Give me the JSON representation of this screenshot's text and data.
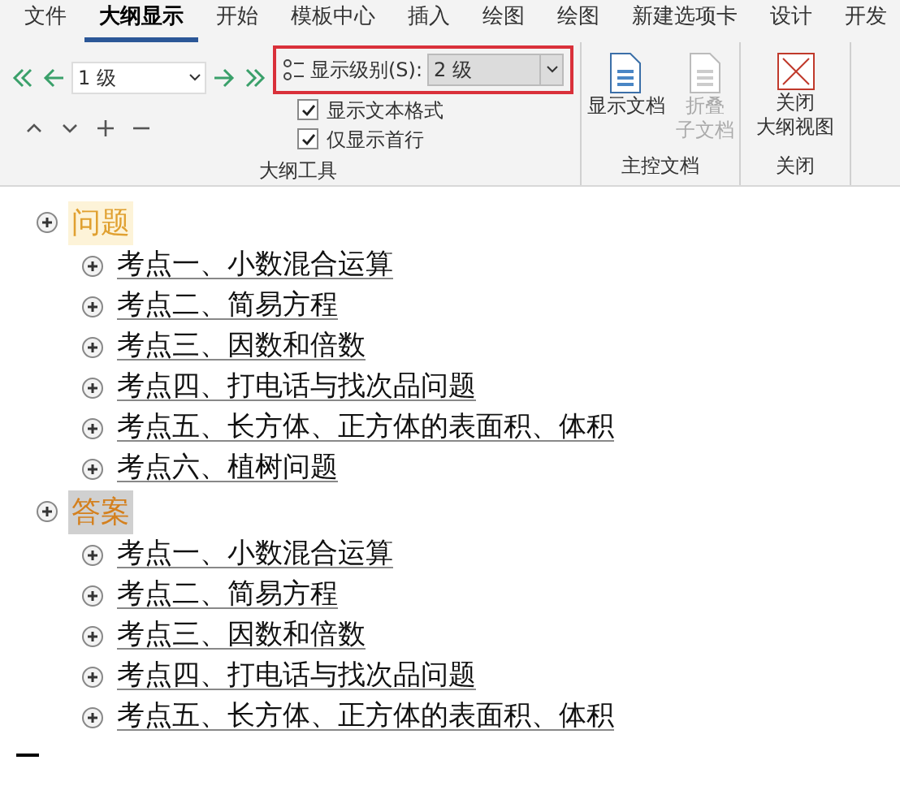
{
  "tabs": [
    {
      "label": "文件",
      "selected": false
    },
    {
      "label": "大纲显示",
      "selected": true
    },
    {
      "label": "开始",
      "selected": false
    },
    {
      "label": "模板中心",
      "selected": false
    },
    {
      "label": "插入",
      "selected": false
    },
    {
      "label": "绘图",
      "selected": false
    },
    {
      "label": "绘图",
      "selected": false
    },
    {
      "label": "新建选项卡",
      "selected": false
    },
    {
      "label": "设计",
      "selected": false
    },
    {
      "label": "开发",
      "selected": false
    }
  ],
  "ribbon": {
    "level_combo": {
      "value": "1 级"
    },
    "show_level": {
      "label": "显示级别(S):",
      "value": "2 级",
      "highlighted": true
    },
    "checkboxes": [
      {
        "label": "显示文本格式",
        "checked": true
      },
      {
        "label": "仅显示首行",
        "checked": true
      }
    ],
    "outline_group_label": "大纲工具",
    "master_buttons": [
      {
        "lines": [
          "显示文档"
        ],
        "disabled": false
      },
      {
        "lines": [
          "折叠",
          "子文档"
        ],
        "disabled": true
      }
    ],
    "master_group_label": "主控文档",
    "close_button": {
      "lines": [
        "关闭",
        "大纲视图"
      ]
    },
    "close_group_label": "关闭"
  },
  "outline": [
    {
      "text": "问题",
      "selected": false,
      "children": [
        {
          "text": "考点一、小数混合运算"
        },
        {
          "text": "考点二、简易方程"
        },
        {
          "text": "考点三、因数和倍数"
        },
        {
          "text": "考点四、打电话与找次品问题"
        },
        {
          "text": "考点五、长方体、正方体的表面积、体积"
        },
        {
          "text": "考点六、植树问题"
        }
      ]
    },
    {
      "text": "答案",
      "selected": true,
      "children": [
        {
          "text": "考点一、小数混合运算"
        },
        {
          "text": "考点二、简易方程"
        },
        {
          "text": "考点三、因数和倍数"
        },
        {
          "text": "考点四、打电话与找次品问题"
        },
        {
          "text": "考点五、长方体、正方体的表面积、体积"
        }
      ]
    }
  ]
}
